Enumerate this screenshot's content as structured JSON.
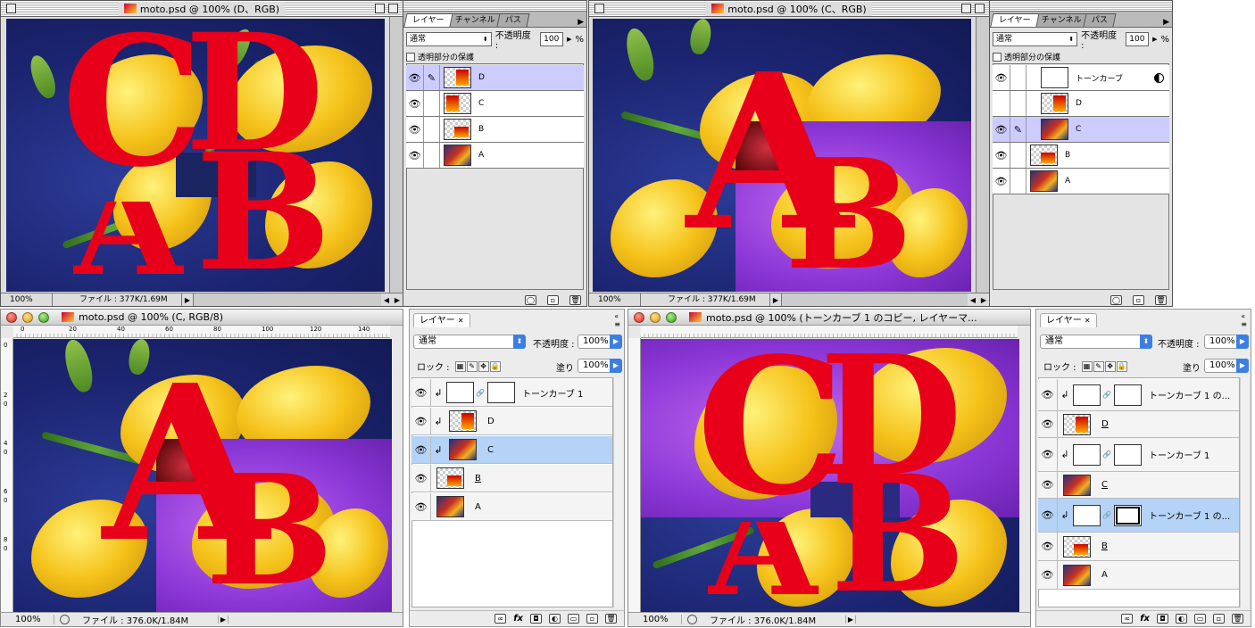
{
  "colors": {
    "letter_red": "#e8001a",
    "selection_os9": "#ccccff",
    "selection_osx": "#b5d3f7",
    "accent_blue": "#3d7fe0"
  },
  "win1": {
    "title": "moto.psd @ 100% (D、RGB)",
    "zoom": "100%",
    "file": "ファイル : 377K/1.69M",
    "letters": [
      "C",
      "D",
      "B",
      "A"
    ]
  },
  "pal1": {
    "tabs": [
      "レイヤー",
      "チャンネル",
      "パス"
    ],
    "blend": "通常",
    "opacity_label": "不透明度 :",
    "opacity": "100",
    "percent": "%",
    "preserve": "透明部分の保護",
    "layers": [
      {
        "name": "D",
        "selected": true
      },
      {
        "name": "C"
      },
      {
        "name": "B"
      },
      {
        "name": "A"
      }
    ]
  },
  "win2": {
    "title": "moto.psd @ 100% (C、RGB)",
    "zoom": "100%",
    "file": "ファイル : 377K/1.69M",
    "letters": [
      "A",
      "B"
    ]
  },
  "pal2": {
    "tabs": [
      "レイヤー",
      "チャンネル",
      "パス"
    ],
    "blend": "通常",
    "opacity_label": "不透明度 :",
    "opacity": "100",
    "percent": "%",
    "preserve": "透明部分の保護",
    "layers": [
      {
        "name": "トーンカーブ"
      },
      {
        "name": "D"
      },
      {
        "name": "C",
        "selected": true
      },
      {
        "name": "B"
      },
      {
        "name": "A"
      }
    ]
  },
  "win3": {
    "title": "moto.psd @ 100% (C, RGB/8)",
    "zoom": "100%",
    "file": "ファイル : 376.0K/1.84M",
    "ruler": [
      "0",
      "20",
      "40",
      "60",
      "80",
      "100",
      "120",
      "140"
    ],
    "vruler": [
      "0",
      "2",
      "0",
      "4",
      "0",
      "6",
      "0",
      "8",
      "0"
    ],
    "letters": [
      "A",
      "B"
    ]
  },
  "pal3": {
    "tab": "レイヤー",
    "blend": "通常",
    "opacity_label": "不透明度 :",
    "opacity": "100%",
    "lock_label": "ロック :",
    "fill_label": "塗り :",
    "fill": "100%",
    "layers": [
      {
        "name": "トーンカーブ 1"
      },
      {
        "name": "D"
      },
      {
        "name": "C",
        "selected": true
      },
      {
        "name": "B"
      },
      {
        "name": "A"
      }
    ]
  },
  "win4": {
    "title": "moto.psd @ 100% (トーンカーブ 1 のコピー, レイヤーマ...",
    "zoom": "100%",
    "file": "ファイル : 376.0K/1.84M",
    "letters": [
      "C",
      "D",
      "B",
      "A"
    ]
  },
  "pal4": {
    "tab": "レイヤー",
    "blend": "通常",
    "opacity_label": "不透明度 :",
    "opacity": "100%",
    "lock_label": "ロック :",
    "fill_label": "塗り :",
    "fill": "100%",
    "layers": [
      {
        "name": "トーンカーブ 1 の..."
      },
      {
        "name": "D"
      },
      {
        "name": "トーンカーブ 1"
      },
      {
        "name": "C"
      },
      {
        "name": "トーンカーブ 1 の...",
        "selected": true
      },
      {
        "name": "B"
      },
      {
        "name": "A"
      }
    ]
  }
}
